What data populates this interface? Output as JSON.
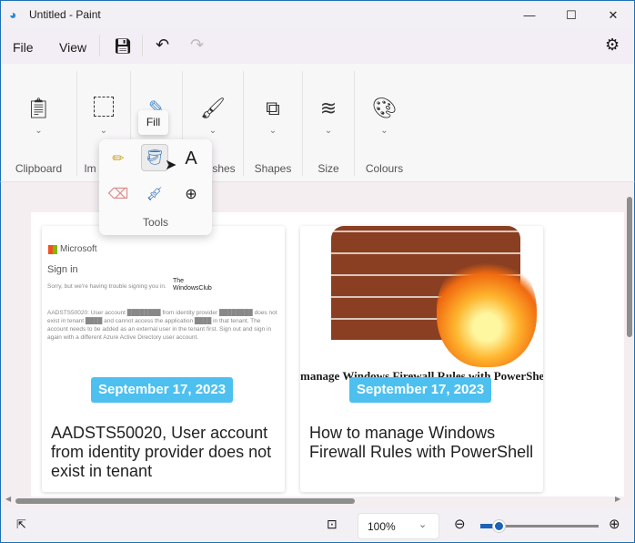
{
  "window": {
    "title": "Untitled - Paint"
  },
  "menu": {
    "file": "File",
    "view": "View"
  },
  "ribbon": {
    "groups": [
      "Clipboard",
      "Image",
      "Tools",
      "Brushes",
      "Shapes",
      "Size",
      "Colours"
    ],
    "image_partial": "Im",
    "brushes_partial": "shes"
  },
  "tooltip": "Fill",
  "tools_popup": {
    "label": "Tools",
    "items": [
      "Pencil",
      "Fill",
      "Text",
      "Eraser",
      "Colour picker",
      "Magnifier"
    ]
  },
  "cards": [
    {
      "date": "September 17, 2023",
      "title": "AADSTS50020, User account from identity provider does not exist in tenant",
      "screenshot": {
        "brand": "Microsoft",
        "heading": "Sign in",
        "sub": "Sorry, but we're having trouble signing you in.",
        "watermark": "The WindowsClub",
        "body": "AADSTS50020: User account ████████ from identity provider ████████ does not exist in tenant ████ and cannot access the application ████ in that tenant. The account needs to be added as an external user in the tenant first. Sign out and sign in again with a different Azure Active Directory user account."
      }
    },
    {
      "date": "September 17, 2023",
      "title": "How to manage Windows Firewall Rules with PowerShell",
      "banner": "manage Windows Firewall Rules with PowerShe"
    }
  ],
  "status": {
    "zoom": "100%",
    "zoom_slider_percent": 12
  }
}
